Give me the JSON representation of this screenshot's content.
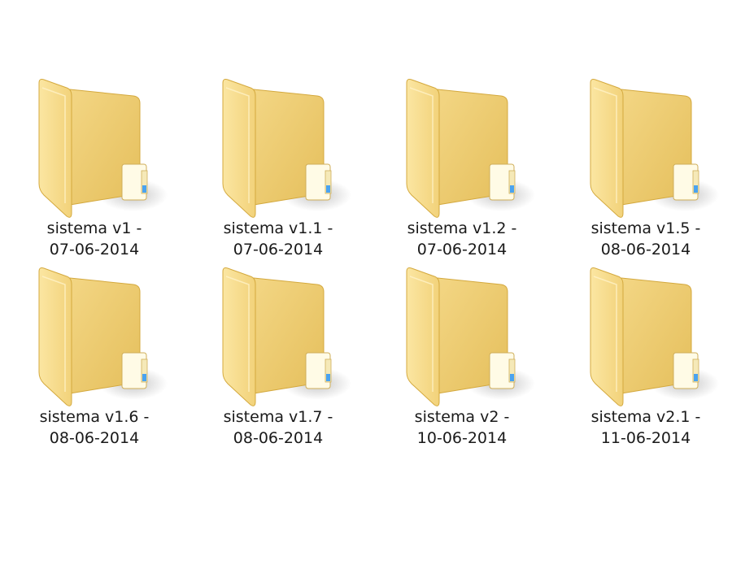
{
  "folders": [
    {
      "name": "sistema v1 -",
      "date": "07-06-2014",
      "icon": "folder-icon"
    },
    {
      "name": "sistema v1.1 -",
      "date": "07-06-2014",
      "icon": "folder-icon"
    },
    {
      "name": "sistema v1.2 -",
      "date": "07-06-2014",
      "icon": "folder-icon"
    },
    {
      "name": "sistema v1.5 -",
      "date": "08-06-2014",
      "icon": "folder-icon"
    },
    {
      "name": "sistema v1.6 -",
      "date": "08-06-2014",
      "icon": "folder-icon"
    },
    {
      "name": "sistema v1.7 -",
      "date": "08-06-2014",
      "icon": "folder-icon"
    },
    {
      "name": "sistema v2 -",
      "date": "10-06-2014",
      "icon": "folder-icon"
    },
    {
      "name": "sistema v2.1 -",
      "date": "11-06-2014",
      "icon": "folder-icon"
    }
  ],
  "colors": {
    "folder_back": "#e8c468",
    "folder_front": "#f7dd8c",
    "folder_edge": "#d4a93e",
    "paper_tab": "#fffbe6",
    "accent_blue": "#4aa3f0"
  }
}
